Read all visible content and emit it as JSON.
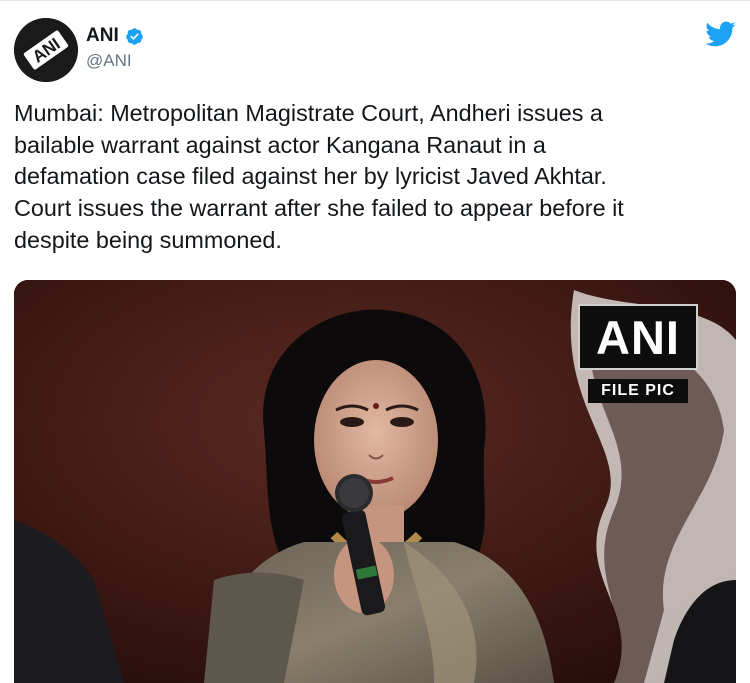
{
  "tweet": {
    "author_name": "ANI",
    "author_handle": "@ANI",
    "avatar_text": "ANI",
    "verified": true,
    "text": "Mumbai: Metropolitan Magistrate Court, Andheri issues a\nbailable warrant against actor Kangana Ranaut in a\ndefamation case filed against her by lyricist Javed Akhtar.\nCourt issues the warrant after she failed to appear before it\ndespite being summoned."
  },
  "media": {
    "watermark_logo": "ANI",
    "watermark_tag": "FILE PIC"
  },
  "icons": {
    "brand": "twitter-bird-icon",
    "verified": "verified-badge-icon"
  },
  "colors": {
    "twitter_blue": "#1da1f2",
    "handle_gray": "#657786",
    "text": "#14171a"
  }
}
